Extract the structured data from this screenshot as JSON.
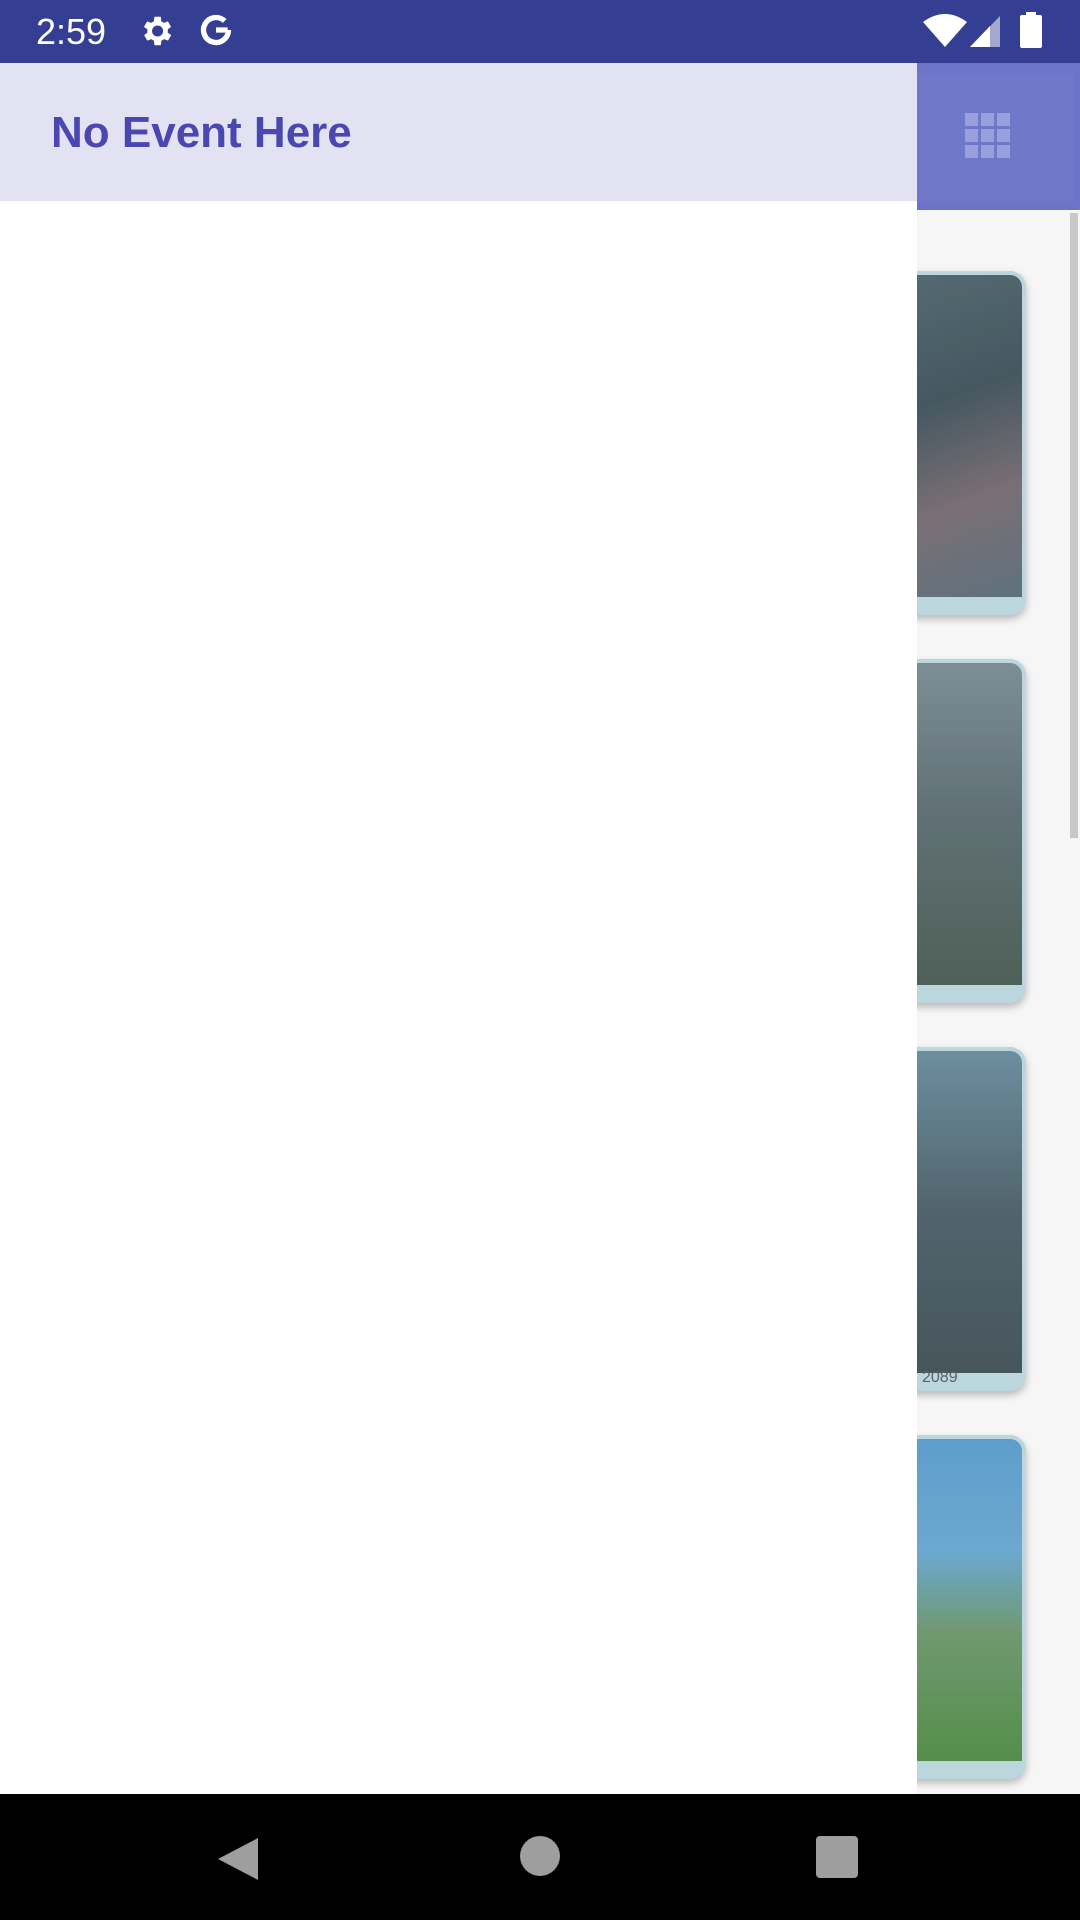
{
  "status_bar": {
    "time": "2:59",
    "icons": [
      "gear-icon",
      "google-g-icon",
      "wifi-icon",
      "signal-icon",
      "battery-icon"
    ]
  },
  "drawer": {
    "header_title": "No Event Here"
  },
  "background_app": {
    "toolbar_action_icon": "grid-view-icon",
    "cards": [
      {
        "caption": ""
      },
      {
        "caption": ""
      },
      {
        "caption": "2089"
      },
      {
        "caption": ""
      }
    ]
  },
  "nav_bar": {
    "icons": [
      "back-icon",
      "home-icon",
      "recents-icon"
    ]
  },
  "colors": {
    "status_bar": "#343f93",
    "drawer_header": "#e2e2f3",
    "title_text": "#4a48b0",
    "toolbar": "#6b74c8"
  }
}
